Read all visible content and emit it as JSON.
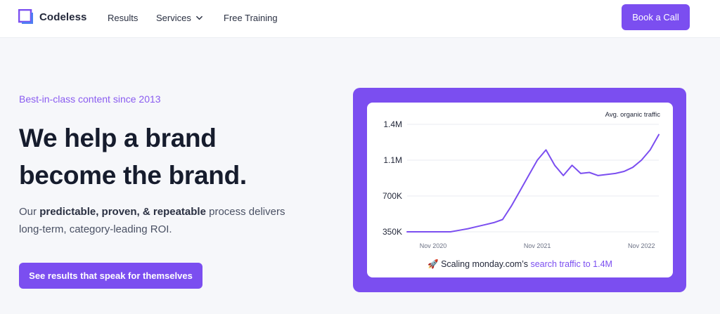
{
  "nav": {
    "brand": "Codeless",
    "links": [
      "Results",
      "Services",
      "Free Training"
    ],
    "cta": "Book a Call"
  },
  "hero": {
    "eyebrow": "Best-in-class content since 2013",
    "headline_line1": "We help a brand",
    "headline_line2": "become the brand.",
    "sub_prefix": "Our ",
    "sub_bold": "predictable, proven, & repeatable",
    "sub_suffix": " process delivers long-term, category-leading ROI.",
    "button": "See results that speak for themselves"
  },
  "chart_card": {
    "caption_emoji": "🚀",
    "caption_text": " Scaling monday.com’s ",
    "caption_highlight": "search traffic to 1.4M"
  },
  "colors": {
    "accent": "#7b4ef0",
    "text": "#161c2d"
  },
  "chart_data": {
    "type": "line",
    "title": "Avg. organic traffic",
    "x_ticks": [
      "Nov 2020",
      "Nov 2021",
      "Nov 2022"
    ],
    "y_ticks": [
      "1.4M",
      "1.1M",
      "700K",
      "350K"
    ],
    "ylim": [
      350000,
      1400000
    ],
    "x": [
      "Aug 2020",
      "Sep 2020",
      "Oct 2020",
      "Nov 2020",
      "Dec 2020",
      "Jan 2021",
      "Feb 2021",
      "Mar 2021",
      "Apr 2021",
      "May 2021",
      "Jun 2021",
      "Jul 2021",
      "Aug 2021",
      "Sep 2021",
      "Oct 2021",
      "Nov 2021",
      "Dec 2021",
      "Jan 2022",
      "Feb 2022",
      "Mar 2022",
      "Apr 2022",
      "May 2022",
      "Jun 2022",
      "Jul 2022",
      "Aug 2022",
      "Sep 2022",
      "Oct 2022",
      "Nov 2022",
      "Dec 2022",
      "Jan 2023"
    ],
    "series": [
      {
        "values": [
          350000,
          350000,
          350000,
          350000,
          350000,
          350000,
          365000,
          380000,
          400000,
          420000,
          440000,
          470000,
          600000,
          750000,
          900000,
          1050000,
          1150000,
          1000000,
          900000,
          1000000,
          920000,
          930000,
          900000,
          910000,
          920000,
          940000,
          980000,
          1050000,
          1150000,
          1300000
        ]
      }
    ],
    "grid": true,
    "color": "#7b4ef0"
  }
}
